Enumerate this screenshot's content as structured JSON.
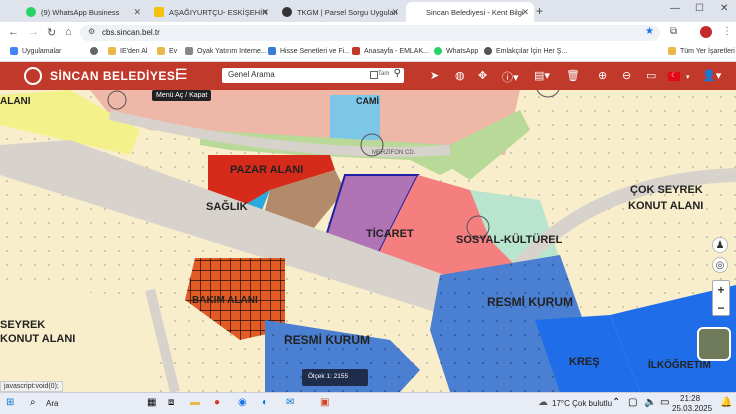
{
  "browser": {
    "tabs": [
      {
        "label": "(9) WhatsApp Business",
        "active": false,
        "color": "#25d366"
      },
      {
        "label": "AŞAĞIYURTÇU- ESKİŞEHİR YOL",
        "active": false,
        "color": "#f4c20d"
      },
      {
        "label": "TKGM | Parsel Sorgu Uygulamas",
        "active": false,
        "color": "#333333"
      },
      {
        "label": "Sincan Belediyesi - Kent Bilgi Si",
        "active": true,
        "color": "#c0392b"
      }
    ],
    "url": "cbs.sincan.bel.tr",
    "bookmarks": [
      "Uygulamalar",
      "IE'den Al",
      "Ev",
      "Oyak Yatırım Interne...",
      "Hisse Senetleri ve Fi...",
      "Anasayfa - EMLAK...",
      "WhatsApp",
      "Emlakçılar İçin Her Ş...",
      "Tüm Yer İşaretleri"
    ],
    "status_link": "javascript:void(0);"
  },
  "app": {
    "brand": "SİNCAN BELEDİYESİ",
    "menu_tooltip": "Menü Aç / Kapat",
    "search_placeholder": "Genel Arama",
    "search_check_label": "Tam",
    "accent": "#c0392b"
  },
  "map": {
    "labels": {
      "pazar_alani": "PAZAR ALANI",
      "saglik": "SAĞLIK",
      "ticaret": "TİCARET",
      "sosyal": "SOSYAL-KÜLTÜREL",
      "cok_seyrek_1": "ÇOK SEYREK",
      "cok_seyrek_2": "KONUT ALANI",
      "resmi_kurum_1": "RESMİ KURUM",
      "resmi_kurum_2": "RESMİ KURUM",
      "bakim_alani": "BAKIM ALANI",
      "kres": "KREŞ",
      "ilkogretim": "İLKÖĞRETİM",
      "cami": "CAMİ",
      "seyrek_1": "SEYREK",
      "konut_alani": "KONUT ALANI",
      "alani": "ALANI",
      "merzifon": "MERZİFON CD."
    },
    "scale_text": "Ölçek 1: 2155"
  },
  "taskbar": {
    "search": "Ara",
    "weather": "17°C  Çok bulutlu",
    "time": "21:28",
    "date": "25.03.2025"
  }
}
